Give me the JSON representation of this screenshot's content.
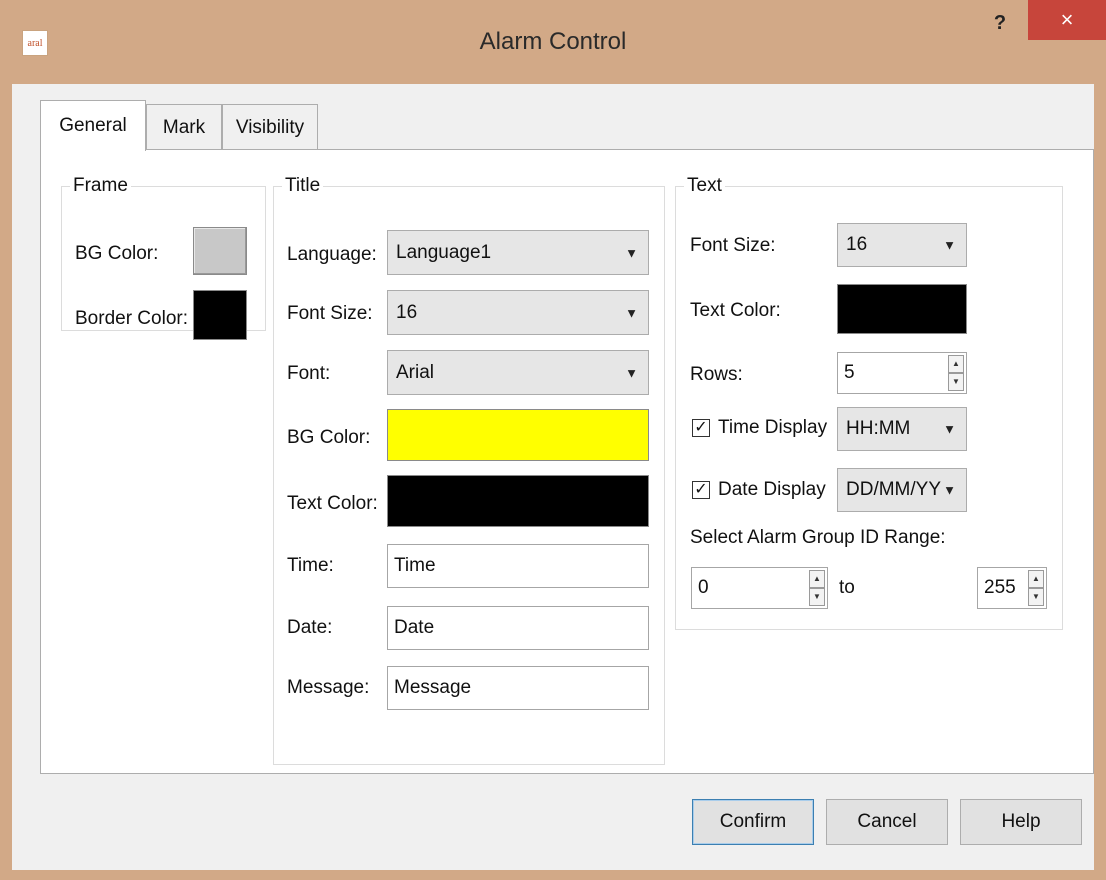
{
  "window": {
    "title": "Alarm Control",
    "app_icon_text": "aral",
    "help_glyph": "?",
    "close_glyph": "×"
  },
  "tabs": [
    {
      "label": "General",
      "active": true
    },
    {
      "label": "Mark",
      "active": false
    },
    {
      "label": "Visibility",
      "active": false
    }
  ],
  "frame": {
    "legend": "Frame",
    "bg_color_label": "BG Color:",
    "bg_color": "#c8c8c8",
    "border_color_label": "Border Color:",
    "border_color": "#000000"
  },
  "title_group": {
    "legend": "Title",
    "language_label": "Language:",
    "language_value": "Language1",
    "font_size_label": "Font Size:",
    "font_size_value": "16",
    "font_label": "Font:",
    "font_value": "Arial",
    "bg_color_label": "BG Color:",
    "bg_color": "#ffff00",
    "text_color_label": "Text Color:",
    "text_color": "#000000",
    "time_label": "Time:",
    "time_value": "Time",
    "date_label": "Date:",
    "date_value": "Date",
    "message_label": "Message:",
    "message_value": "Message"
  },
  "text_group": {
    "legend": "Text",
    "font_size_label": "Font Size:",
    "font_size_value": "16",
    "text_color_label": "Text Color:",
    "text_color": "#000000",
    "rows_label": "Rows:",
    "rows_value": "5",
    "time_display_label": "Time Display",
    "time_display_checked": true,
    "time_format": "HH:MM",
    "date_display_label": "Date Display",
    "date_display_checked": true,
    "date_format": "DD/MM/YY",
    "range_label": "Select Alarm Group ID Range:",
    "range_from": "0",
    "range_to_label": "to",
    "range_to": "255"
  },
  "buttons": {
    "confirm": "Confirm",
    "cancel": "Cancel",
    "help": "Help"
  },
  "glyphs": {
    "check": "✓",
    "dropdown": "▼",
    "spin_up": "▲",
    "spin_down": "▼"
  }
}
